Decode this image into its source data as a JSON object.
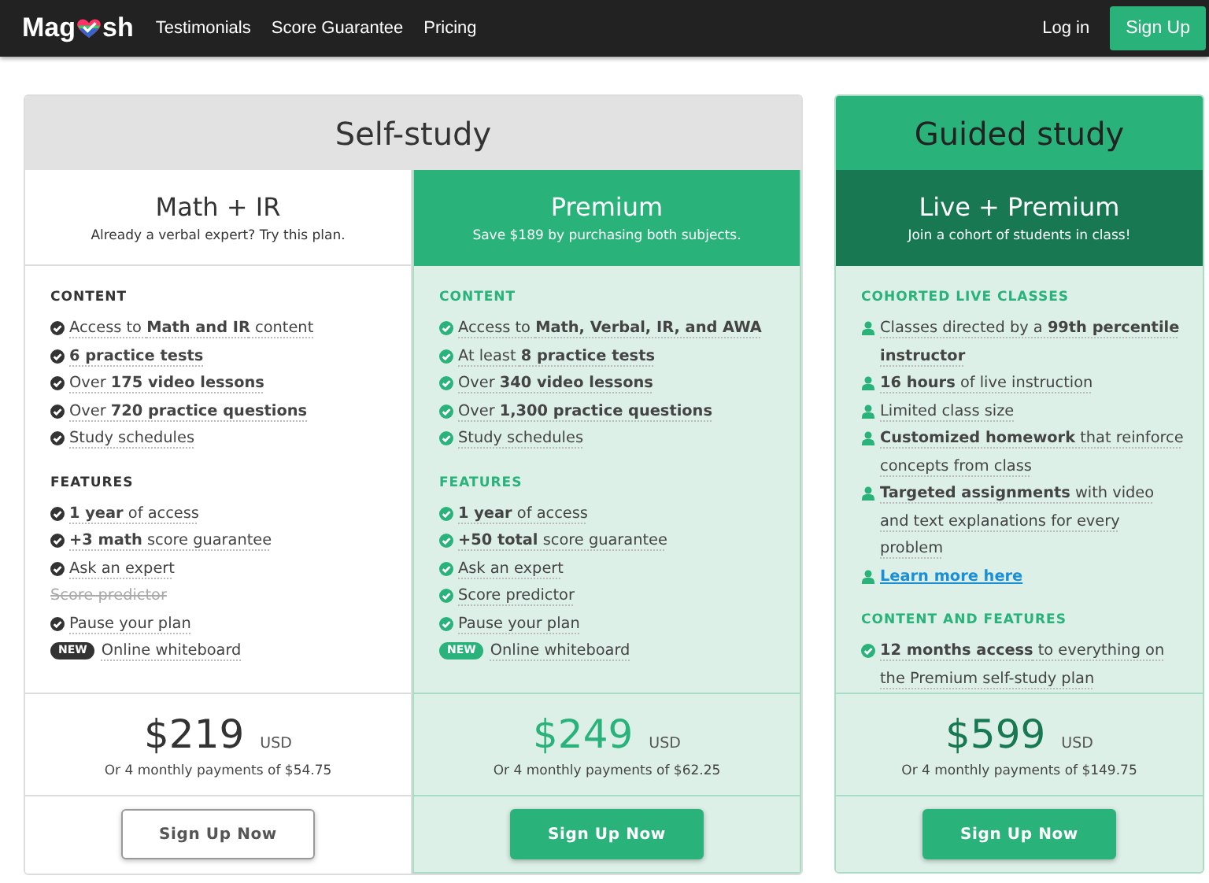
{
  "nav": {
    "logo_start": "Mag",
    "logo_end": "sh",
    "links": [
      "Testimonials",
      "Score Guarantee",
      "Pricing"
    ],
    "login": "Log in",
    "signup": "Sign Up"
  },
  "groups": [
    {
      "title": "Self-study",
      "plans": [
        {
          "name": "Math + IR",
          "subtitle": "Already a verbal expert? Try this plan.",
          "sections": [
            {
              "heading": "CONTENT",
              "items": [
                {
                  "kind": "check",
                  "text": "Access to **Math and IR** content"
                },
                {
                  "kind": "check",
                  "text": "**6 practice tests**"
                },
                {
                  "kind": "check",
                  "text": "Over **175 video lessons**"
                },
                {
                  "kind": "check",
                  "text": "Over **720 practice questions**"
                },
                {
                  "kind": "check",
                  "text": "Study schedules"
                }
              ]
            },
            {
              "heading": "FEATURES",
              "items": [
                {
                  "kind": "check",
                  "text": "**1 year** of access"
                },
                {
                  "kind": "check",
                  "text": "**+3 math** score guarantee"
                },
                {
                  "kind": "check",
                  "text": "Ask an expert"
                },
                {
                  "kind": "unavailable",
                  "text": "Score predictor"
                },
                {
                  "kind": "check",
                  "text": "Pause your plan"
                },
                {
                  "kind": "badge",
                  "badge": "NEW",
                  "text": "Online whiteboard"
                }
              ]
            }
          ],
          "price": "$219",
          "currency": "USD",
          "installments": "Or 4 monthly payments of $54.75",
          "button": {
            "label": "Sign Up Now"
          }
        },
        {
          "name": "Premium",
          "subtitle": "Save $189 by purchasing both subjects.",
          "sections": [
            {
              "heading": "CONTENT",
              "items": [
                {
                  "kind": "check",
                  "text": "Access to **Math, Verbal, IR, and AWA**"
                },
                {
                  "kind": "check",
                  "text": "At least **8 practice tests**"
                },
                {
                  "kind": "check",
                  "text": "Over **340 video lessons**"
                },
                {
                  "kind": "check",
                  "text": "Over **1,300 practice questions**"
                },
                {
                  "kind": "check",
                  "text": "Study schedules"
                }
              ]
            },
            {
              "heading": "FEATURES",
              "items": [
                {
                  "kind": "check",
                  "text": "**1 year** of access"
                },
                {
                  "kind": "check",
                  "text": "**+50 total** score guarantee"
                },
                {
                  "kind": "check",
                  "text": "Ask an expert"
                },
                {
                  "kind": "check",
                  "text": "Score predictor"
                },
                {
                  "kind": "check",
                  "text": "Pause your plan"
                },
                {
                  "kind": "badge",
                  "badge": "NEW",
                  "text": "Online whiteboard"
                }
              ]
            }
          ],
          "price": "$249",
          "currency": "USD",
          "installments": "Or 4 monthly payments of $62.25",
          "button": {
            "label": "Sign Up Now"
          }
        }
      ]
    },
    {
      "title": "Guided study",
      "plans": [
        {
          "name": "Live + Premium",
          "subtitle": "Join a cohort of students in class!",
          "sections": [
            {
              "heading": "COHORTED LIVE CLASSES",
              "items": [
                {
                  "kind": "person",
                  "text": "Classes directed by a **99th percentile instructor**"
                },
                {
                  "kind": "person",
                  "text": "**16 hours** of live instruction"
                },
                {
                  "kind": "person",
                  "text": "Limited class size"
                },
                {
                  "kind": "person",
                  "text": "**Customized homework** that reinforce concepts from class"
                },
                {
                  "kind": "person",
                  "text": "**Targeted assignments** with video and text explanations for every problem"
                },
                {
                  "kind": "link",
                  "text": "**Learn more here**"
                }
              ]
            },
            {
              "heading": "CONTENT AND FEATURES",
              "items": [
                {
                  "kind": "check",
                  "text": "**12 months access** to everything on the Premium self-study plan"
                }
              ]
            }
          ],
          "price": "$599",
          "currency": "USD",
          "installments": "Or 4 monthly payments of $149.75",
          "button": {
            "label": "Sign Up Now"
          }
        }
      ]
    }
  ]
}
